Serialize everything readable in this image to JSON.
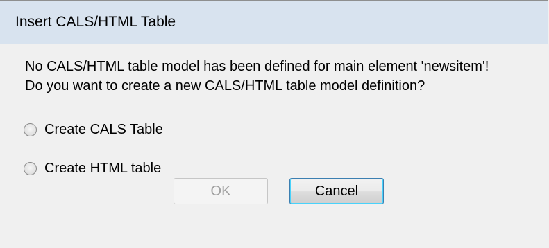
{
  "dialog": {
    "title": "Insert CALS/HTML Table",
    "message_line1": "No CALS/HTML table model has been defined for main element 'newsitem'!",
    "message_line2": "Do you want to create a new CALS/HTML table model definition?",
    "options": [
      {
        "label": "Create CALS Table",
        "selected": false
      },
      {
        "label": "Create HTML table",
        "selected": false
      }
    ],
    "ok_label": "OK",
    "cancel_label": "Cancel",
    "ok_enabled": false
  }
}
